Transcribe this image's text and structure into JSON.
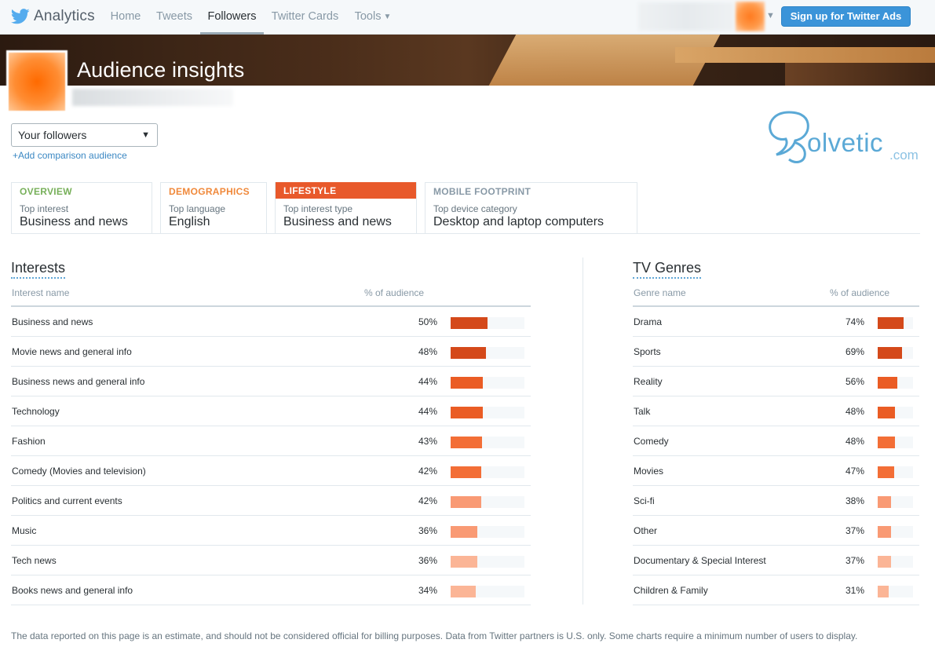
{
  "nav": {
    "brand": "Analytics",
    "items": [
      {
        "label": "Home"
      },
      {
        "label": "Tweets"
      },
      {
        "label": "Followers"
      },
      {
        "label": "Twitter Cards"
      },
      {
        "label": "Tools"
      }
    ],
    "signup_label": "Sign up for Twitter Ads",
    "caret_glyph": "⌄"
  },
  "header": {
    "title": "Audience insights"
  },
  "audience": {
    "selected": "Your followers",
    "add_comparison": "+Add comparison audience"
  },
  "watermark": {
    "text": "olvetic",
    "suffix": ".com",
    "color": "#5ba9d6"
  },
  "tabs": [
    {
      "title": "OVERVIEW",
      "label": "Top interest",
      "value": "Business and news",
      "color": "#77b05a"
    },
    {
      "title": "DEMOGRAPHICS",
      "label": "Top language",
      "value": "English",
      "color": "#f0893b"
    },
    {
      "title": "LIFESTYLE",
      "label": "Top interest type",
      "value": "Business and news",
      "color": "#e8592b"
    },
    {
      "title": "MOBILE FOOTPRINT",
      "label": "Top device category",
      "value": "Desktop and laptop computers",
      "color": "#8899a6"
    }
  ],
  "interests": {
    "title": "Interests",
    "col_name": "Interest name",
    "col_pct": "% of audience",
    "rows": [
      {
        "name": "Business and news",
        "pct": "50%",
        "value": 50,
        "color": "#d4491a"
      },
      {
        "name": "Movie news and general info",
        "pct": "48%",
        "value": 48,
        "color": "#d4491a"
      },
      {
        "name": "Business news and general info",
        "pct": "44%",
        "value": 44,
        "color": "#ea5c24"
      },
      {
        "name": "Technology",
        "pct": "44%",
        "value": 44,
        "color": "#ea5c24"
      },
      {
        "name": "Fashion",
        "pct": "43%",
        "value": 43,
        "color": "#f36e36"
      },
      {
        "name": "Comedy (Movies and television)",
        "pct": "42%",
        "value": 42,
        "color": "#f36e36"
      },
      {
        "name": "Politics and current events",
        "pct": "42%",
        "value": 42,
        "color": "#f99a74"
      },
      {
        "name": "Music",
        "pct": "36%",
        "value": 36,
        "color": "#f99a74"
      },
      {
        "name": "Tech news",
        "pct": "36%",
        "value": 36,
        "color": "#fbb596"
      },
      {
        "name": "Books news and general info",
        "pct": "34%",
        "value": 34,
        "color": "#fbb596"
      }
    ]
  },
  "tv_genres": {
    "title": "TV Genres",
    "col_name": "Genre name",
    "col_pct": "% of audience",
    "rows": [
      {
        "name": "Drama",
        "pct": "74%",
        "value": 74,
        "color": "#d4491a"
      },
      {
        "name": "Sports",
        "pct": "69%",
        "value": 69,
        "color": "#d4491a"
      },
      {
        "name": "Reality",
        "pct": "56%",
        "value": 56,
        "color": "#ea5c24"
      },
      {
        "name": "Talk",
        "pct": "48%",
        "value": 48,
        "color": "#ea5c24"
      },
      {
        "name": "Comedy",
        "pct": "48%",
        "value": 48,
        "color": "#f36e36"
      },
      {
        "name": "Movies",
        "pct": "47%",
        "value": 47,
        "color": "#f36e36"
      },
      {
        "name": "Sci-fi",
        "pct": "38%",
        "value": 38,
        "color": "#f99a74"
      },
      {
        "name": "Other",
        "pct": "37%",
        "value": 37,
        "color": "#f99a74"
      },
      {
        "name": "Documentary & Special Interest",
        "pct": "37%",
        "value": 37,
        "color": "#fbb596"
      },
      {
        "name": "Children & Family",
        "pct": "31%",
        "value": 31,
        "color": "#fbb596"
      }
    ]
  },
  "footnote": "The data reported on this page is an estimate, and should not be considered official for billing purposes. Data from Twitter partners is U.S. only. Some charts require a minimum number of users to display.",
  "colors": {
    "accent": "#e8592b",
    "link": "#3b88c3",
    "ads_button": "#3b94d9"
  }
}
